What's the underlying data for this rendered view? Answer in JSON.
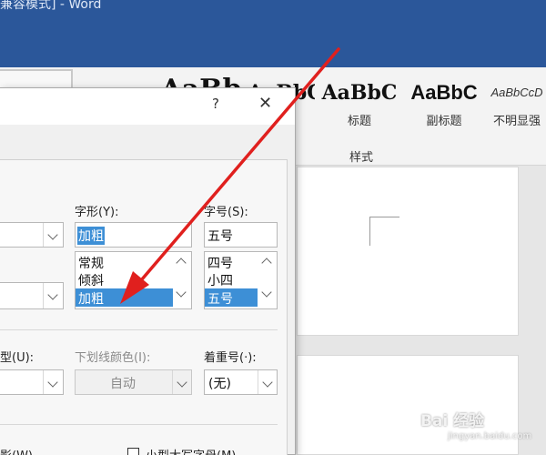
{
  "window": {
    "title": "兼容模式] - Word"
  },
  "ribbon": {
    "styles": [
      {
        "sample": "AaBb",
        "name": ""
      },
      {
        "sample": "AaBbC",
        "name": ""
      },
      {
        "sample": "AaBbC",
        "name": "标题"
      },
      {
        "sample": "AaBbC",
        "name": "副标题"
      },
      {
        "sample": "AaBbCcD",
        "name": "不明显强"
      }
    ],
    "group_label": "样式"
  },
  "dialog": {
    "help": "?",
    "close": "✕",
    "font_style": {
      "label": "字形(Y):",
      "value": "加粗",
      "options": [
        "常规",
        "倾斜",
        "加粗"
      ],
      "selected": "加粗"
    },
    "font_size": {
      "label": "字号(S):",
      "value": "五号",
      "options": [
        "四号",
        "小四",
        "五号"
      ],
      "selected": "五号"
    },
    "underline_type": {
      "label": "型(U):"
    },
    "underline_color": {
      "label": "下划线颜色(I):",
      "value": "自动"
    },
    "emphasis": {
      "label": "着重号(·):",
      "value": "(无)"
    },
    "bottom_left_label": "影(W)",
    "small_caps": {
      "label": "小型大写字母(M)"
    }
  },
  "watermark": {
    "brand": "Bai 经验",
    "sub": "jingyan.baidu.com"
  }
}
